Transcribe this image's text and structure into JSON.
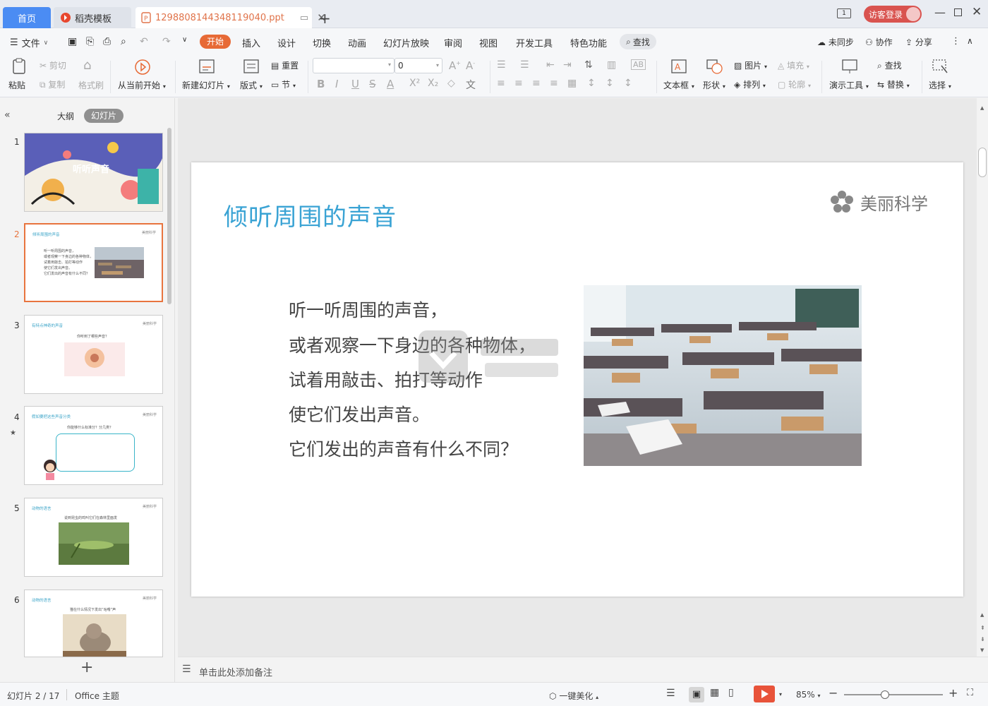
{
  "titlebar": {
    "tabs": [
      {
        "label": "首页"
      },
      {
        "label": "稻壳模板"
      },
      {
        "label": "1298808144348119040.ppt"
      }
    ],
    "guest_login": "访客登录",
    "page_indicator": "1"
  },
  "menu": {
    "file": "文件",
    "items": [
      "开始",
      "插入",
      "设计",
      "切换",
      "动画",
      "幻灯片放映",
      "审阅",
      "视图",
      "开发工具",
      "特色功能"
    ],
    "search": "查找",
    "sync": "未同步",
    "collab": "协作",
    "share": "分享"
  },
  "ribbon": {
    "paste": "粘贴",
    "cut": "剪切",
    "copy": "复制",
    "format_painter": "格式刷",
    "play_from_current": "从当前开始",
    "new_slide": "新建幻灯片",
    "layout": "版式",
    "reset": "重置",
    "section": "节",
    "font_size_value": "0",
    "textbox": "文本框",
    "shape": "形状",
    "picture": "图片",
    "fill": "填充",
    "arrange": "排列",
    "outline": "轮廓",
    "presentation_tools": "演示工具",
    "find": "查找",
    "replace": "替换",
    "select": "选择"
  },
  "leftpanel": {
    "outline_tab": "大纲",
    "slides_tab": "幻灯片",
    "thumbnails": [
      {
        "num": "1",
        "title": "听听声音"
      },
      {
        "num": "2",
        "title": "倾听周围的声音",
        "lines": [
          "听一听周围的声音，",
          "或者观察一下身边的各种物体，",
          "试着用敲击、拍打等动作",
          "使它们发出声音。",
          "它们发出的声音有什么不同？"
        ]
      },
      {
        "num": "3",
        "title": "有特点神奇的声音",
        "sub": "你听到了哪些声音？"
      },
      {
        "num": "4",
        "title": "假如要把这些声音分类",
        "sub": "你能够什么标准分？分几类？"
      },
      {
        "num": "5",
        "title": "动物的语言",
        "sub": "说到昆虫的鸣叫它们在森林里面发"
      },
      {
        "num": "6",
        "title": "动物的语言",
        "sub": "猫在什么情况下发出“咕噜”声"
      }
    ],
    "logo_small": "美丽科学"
  },
  "slide": {
    "title": "倾听周围的声音",
    "logo": "美丽科学",
    "body": [
      "听一听周围的声音，",
      "或者观察一下身边的各种物体，",
      "试着用敲击、拍打等动作",
      "使它们发出声音。",
      "它们发出的声音有什么不同？"
    ]
  },
  "notes_placeholder": "单击此处添加备注",
  "status": {
    "slide_counter": "幻灯片 2 / 17",
    "theme": "Office 主题",
    "beautify": "一键美化",
    "zoom": "85%"
  },
  "colors": {
    "accent": "#e76a36",
    "title_blue": "#3aa3d4",
    "home_tab": "#4b8cf3",
    "login": "#d9534f"
  }
}
